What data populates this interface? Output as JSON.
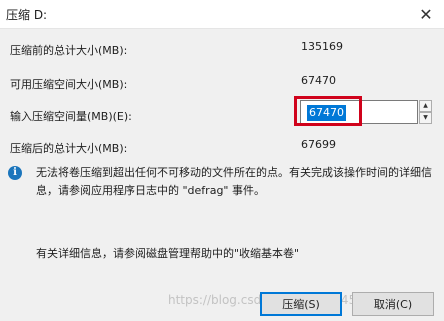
{
  "window": {
    "title": "压缩 D:",
    "close_glyph": "✕"
  },
  "rows": {
    "total_before_label": "压缩前的总计大小(MB):",
    "total_before_value": "135169",
    "available_label": "可用压缩空间大小(MB):",
    "available_value": "67470",
    "input_label": "输入压缩空间量(MB)(E):",
    "input_value": "67470",
    "total_after_label": "压缩后的总计大小(MB):",
    "total_after_value": "67699"
  },
  "info": {
    "icon": "info-icon",
    "text": "无法将卷压缩到超出任何不可移动的文件所在的点。有关完成该操作时间的详细信息，请参阅应用程序日志中的 \"defrag\" 事件。"
  },
  "help": {
    "text": "有关详细信息，请参阅磁盘管理帮助中的\"收缩基本卷\""
  },
  "buttons": {
    "shrink": "压缩(S)",
    "cancel": "取消(C)"
  },
  "watermark": "https://blog.csdn.net/weixin_45799"
}
